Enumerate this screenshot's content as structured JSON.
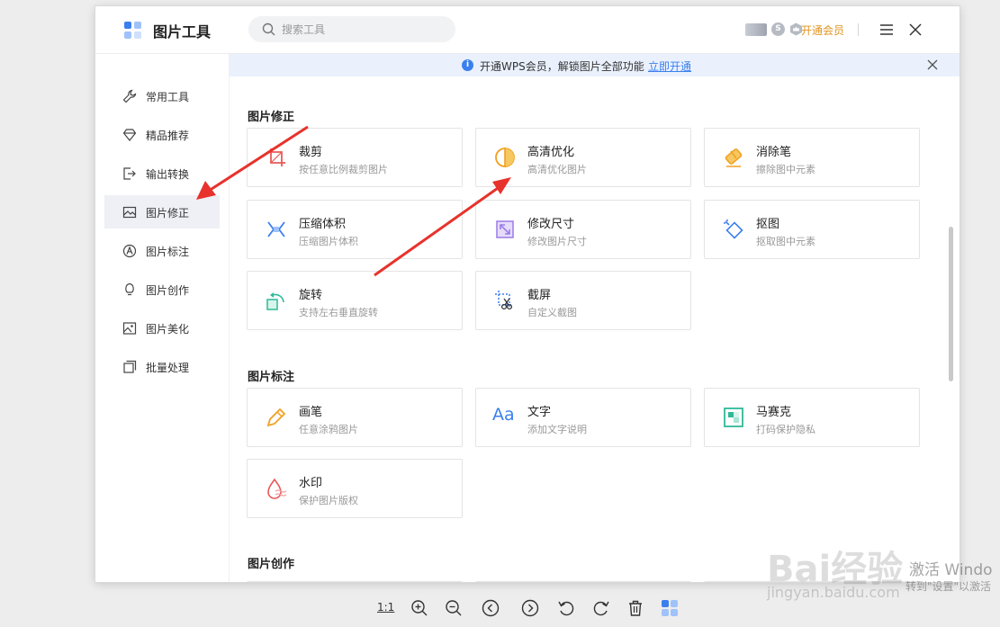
{
  "app": {
    "title": "图片工具"
  },
  "search": {
    "placeholder": "搜索工具"
  },
  "header": {
    "coin_label": "S",
    "vip_label": "开通会员"
  },
  "banner": {
    "info_glyph": "i",
    "message": "开通WPS会员，解锁图片全部功能",
    "link": "立即开通"
  },
  "sidebar": {
    "items": [
      {
        "label": "常用工具",
        "icon": "wrench-icon"
      },
      {
        "label": "精品推荐",
        "icon": "diamond-icon"
      },
      {
        "label": "输出转换",
        "icon": "export-icon"
      },
      {
        "label": "图片修正",
        "icon": "image-fix-icon",
        "active": true
      },
      {
        "label": "图片标注",
        "icon": "annotate-icon"
      },
      {
        "label": "图片创作",
        "icon": "bulb-icon"
      },
      {
        "label": "图片美化",
        "icon": "picture-icon"
      },
      {
        "label": "批量处理",
        "icon": "batch-icon"
      }
    ]
  },
  "sections": [
    {
      "title": "图片修正",
      "cards": [
        {
          "title": "裁剪",
          "desc": "按任意比例裁剪图片",
          "icon": "crop-icon"
        },
        {
          "title": "高清优化",
          "desc": "高清优化图片",
          "icon": "hd-icon"
        },
        {
          "title": "消除笔",
          "desc": "擦除图中元素",
          "icon": "eraser-icon"
        },
        {
          "title": "压缩体积",
          "desc": "压缩图片体积",
          "icon": "compress-icon"
        },
        {
          "title": "修改尺寸",
          "desc": "修改图片尺寸",
          "icon": "resize-icon"
        },
        {
          "title": "抠图",
          "desc": "抠取图中元素",
          "icon": "cutout-icon"
        },
        {
          "title": "旋转",
          "desc": "支持左右垂直旋转",
          "icon": "rotate-icon"
        },
        {
          "title": "截屏",
          "desc": "自定义截图",
          "icon": "screenshot-icon"
        }
      ]
    },
    {
      "title": "图片标注",
      "cards": [
        {
          "title": "画笔",
          "desc": "任意涂鸦图片",
          "icon": "pen-icon"
        },
        {
          "title": "文字",
          "desc": "添加文字说明",
          "icon": "text-icon"
        },
        {
          "title": "马赛克",
          "desc": "打码保护隐私",
          "icon": "mosaic-icon"
        },
        {
          "title": "水印",
          "desc": "保护图片版权",
          "icon": "watermark-icon"
        }
      ]
    },
    {
      "title": "图片创作"
    }
  ],
  "text_icon_glyph": "Aa",
  "bottom": {
    "ratio": "1:1"
  },
  "watermark": {
    "brand": "Bai经验",
    "url": "jingyan.baidu.com",
    "os1": "激活 Windo",
    "os2": "转到\"设置\"以激活"
  },
  "colors": {
    "accent": "#3b7fee",
    "vip": "#e09520",
    "arrow": "#e8322c",
    "active_bg": "#eef0f5"
  }
}
